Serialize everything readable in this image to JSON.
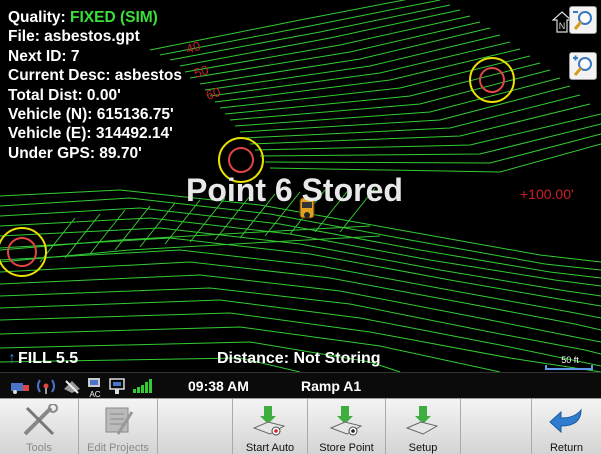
{
  "info": {
    "quality_label": "Quality:",
    "quality_value": "FIXED (SIM)",
    "file": "File: asbestos.gpt",
    "next_id": "Next ID: 7",
    "current_desc": "Current Desc: asbestos",
    "total_dist": "Total Dist: 0.00'",
    "vehicle_n": "Vehicle (N): 615136.75'",
    "vehicle_e": "Vehicle (E): 314492.14'",
    "under_gps": "Under GPS: 89.70'"
  },
  "map": {
    "contour_labels": [
      "40",
      "50",
      "60"
    ],
    "status_message": "Point 6 Stored",
    "offset": "+100.00'",
    "fill": "FILL 5.5",
    "distance": "Distance: Not Storing",
    "scale": "50 ft",
    "north": "N"
  },
  "statusbar": {
    "time": "09:38 AM",
    "location": "Ramp A1",
    "ac_label": "AC"
  },
  "toolbar": {
    "buttons": [
      {
        "label": "Tools",
        "enabled": false,
        "icon": "tools-icon"
      },
      {
        "label": "Edit Projects",
        "enabled": false,
        "icon": "edit-projects-icon"
      },
      {
        "label": "",
        "enabled": false,
        "icon": ""
      },
      {
        "label": "Start Auto",
        "enabled": true,
        "icon": "start-auto-icon"
      },
      {
        "label": "Store Point",
        "enabled": true,
        "icon": "store-point-icon"
      },
      {
        "label": "Setup",
        "enabled": true,
        "icon": "setup-icon"
      },
      {
        "label": "",
        "enabled": false,
        "icon": ""
      },
      {
        "label": "Return",
        "enabled": true,
        "icon": "return-icon"
      }
    ]
  },
  "colors": {
    "quality_fixed": "#3adf3a",
    "contour_line": "#33cc33",
    "contour_label": "#c0202a",
    "target_outer": "#e8e000",
    "target_inner": "#e04545",
    "scale_bar": "#5a9ae8"
  }
}
